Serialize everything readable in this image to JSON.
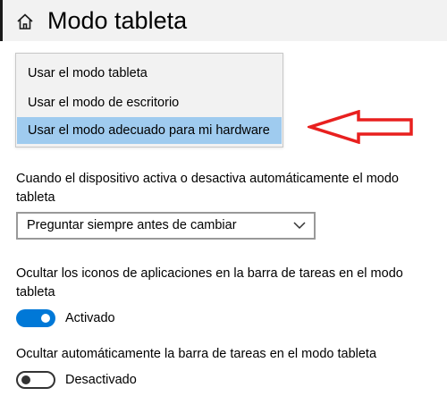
{
  "header": {
    "title": "Modo tableta",
    "icon": "home-icon"
  },
  "signin_dropdown": {
    "options": [
      "Usar el modo tableta",
      "Usar el modo de escritorio",
      "Usar el modo adecuado para mi hardware"
    ],
    "selected_index": 2,
    "highlight_color": "#9fcbef"
  },
  "annotation": {
    "icon": "red-arrow-icon",
    "color": "#e8201f"
  },
  "auto_switch": {
    "label": "Cuando el dispositivo activa o desactiva automáticamente el modo tableta",
    "value": "Preguntar siempre antes de cambiar",
    "icon": "chevron-down-icon"
  },
  "hide_icons": {
    "label": "Ocultar los iconos de aplicaciones en la barra de tareas en el modo tableta",
    "state": "on",
    "state_label": "Activado",
    "accent_color": "#0078d7"
  },
  "hide_taskbar": {
    "label": "Ocultar automáticamente la barra de tareas en el modo tableta",
    "state": "off",
    "state_label": "Desactivado"
  }
}
